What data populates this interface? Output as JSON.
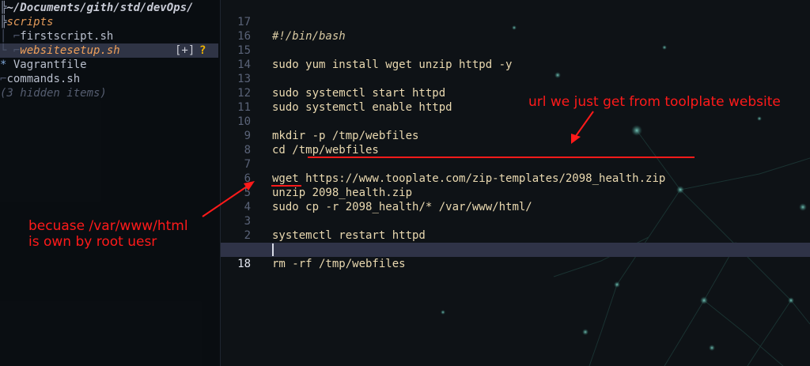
{
  "file_tree": {
    "root_path": "~/Documents/gith/std/devOps/",
    "folder": "scripts",
    "items": [
      {
        "name": "firstscript.sh"
      },
      {
        "name": "websitesetup.sh",
        "selected": true,
        "flag": "[+]",
        "status": "?"
      },
      {
        "name": "Vagrantfile",
        "marker": "*"
      },
      {
        "name": "commands.sh"
      }
    ],
    "hidden_note": "(3 hidden items)"
  },
  "editor": {
    "lines": [
      {
        "num": "17",
        "text": "#!/bin/bash"
      },
      {
        "num": "16",
        "text": ""
      },
      {
        "num": "15",
        "text": "sudo yum install wget unzip httpd -y"
      },
      {
        "num": "14",
        "text": ""
      },
      {
        "num": "13",
        "text": "sudo systemctl start httpd"
      },
      {
        "num": "12",
        "text": "sudo systemctl enable httpd"
      },
      {
        "num": "11",
        "text": ""
      },
      {
        "num": "10",
        "text": "mkdir -p /tmp/webfiles"
      },
      {
        "num": "9",
        "text": "cd /tmp/webfiles"
      },
      {
        "num": "8",
        "text": ""
      },
      {
        "num": "7",
        "cmd": "wget",
        "arg": "https://www.tooplate.com/zip-templates/2098_health.zip"
      },
      {
        "num": "6",
        "text": "unzip 2098_health.zip"
      },
      {
        "num": "5",
        "cmd": "sudo",
        "arg": "cp -r 2098_health/* /var/www/html/"
      },
      {
        "num": "4",
        "text": ""
      },
      {
        "num": "3",
        "text": "systemctl restart httpd"
      },
      {
        "num": "2",
        "text": ""
      },
      {
        "num": "1",
        "text": "rm -rf /tmp/webfiles"
      },
      {
        "num": "18",
        "text": "",
        "current": true
      }
    ]
  },
  "annotations": {
    "url_note": "url we just get from toolplate website",
    "root_note_line1": "becuase /var/www/html",
    "root_note_line2": "is own by root uesr"
  },
  "colors": {
    "annotation_red": "#ff1a1a",
    "selected_row_bg": "#2f3445",
    "folder_orange": "#e49b5a",
    "code_text": "#ead9b0"
  }
}
